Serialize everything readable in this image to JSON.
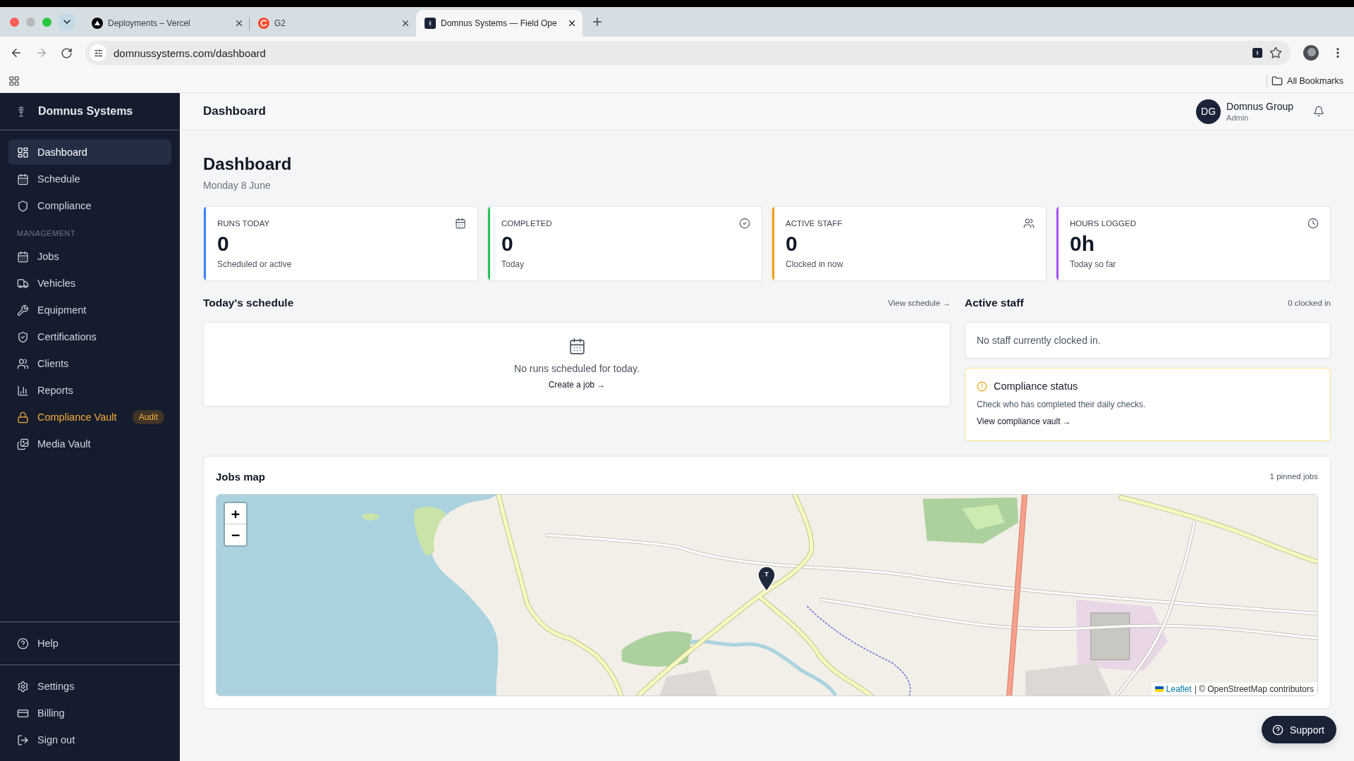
{
  "browser": {
    "tabs": [
      {
        "title": "Deployments – Vercel",
        "selected": false
      },
      {
        "title": "G2",
        "selected": false
      },
      {
        "title": "Domnus Systems — Field Ope",
        "selected": true
      }
    ],
    "forward_disabled": true,
    "url": "domnussystems.com/dashboard",
    "bookmarks_folder": "All Bookmarks"
  },
  "sidebar": {
    "brand": "Domnus Systems",
    "nav_groups": [
      {
        "items": [
          {
            "label": "Dashboard",
            "selected": true,
            "highlighted": false
          },
          {
            "label": "Schedule",
            "selected": false,
            "highlighted": false
          },
          {
            "label": "Compliance",
            "selected": false,
            "highlighted": false
          }
        ]
      },
      {
        "heading": "MANAGEMENT",
        "items": [
          {
            "label": "Jobs",
            "selected": false,
            "highlighted": false
          },
          {
            "label": "Vehicles",
            "selected": false,
            "highlighted": false
          },
          {
            "label": "Equipment",
            "selected": false,
            "highlighted": false
          },
          {
            "label": "Certifications",
            "selected": false,
            "highlighted": false
          },
          {
            "label": "Clients",
            "selected": false,
            "highlighted": false
          },
          {
            "label": "Reports",
            "selected": false,
            "highlighted": false
          },
          {
            "label": "Compliance Vault",
            "selected": false,
            "highlighted": true,
            "badge": "Audit"
          },
          {
            "label": "Media Vault",
            "selected": false,
            "highlighted": false
          }
        ]
      }
    ],
    "footer_groups": [
      {
        "items": [
          {
            "label": "Help",
            "selected": false,
            "highlighted": false
          }
        ]
      },
      {
        "items": [
          {
            "label": "Settings",
            "selected": false,
            "highlighted": false
          },
          {
            "label": "Billing",
            "selected": false,
            "highlighted": false
          },
          {
            "label": "Sign out",
            "selected": false,
            "highlighted": false
          }
        ]
      }
    ]
  },
  "header": {
    "title": "Dashboard",
    "user": {
      "initials": "DG",
      "name": "Domnus Group",
      "role": "Admin"
    }
  },
  "page": {
    "title": "Dashboard",
    "date": "Monday 8 June"
  },
  "stats": [
    {
      "label": "RUNS TODAY",
      "value": "0",
      "caption": "Scheduled or active",
      "color": "#3b82f6"
    },
    {
      "label": "COMPLETED",
      "value": "0",
      "caption": "Today",
      "color": "#22c55e"
    },
    {
      "label": "ACTIVE STAFF",
      "value": "0",
      "caption": "Clocked in now",
      "color": "#f59e0b"
    },
    {
      "label": "HOURS LOGGED",
      "value": "0h",
      "caption": "Today so far",
      "color": "#a855f7"
    }
  ],
  "schedule": {
    "title": "Today's schedule",
    "link": "View schedule →",
    "empty_text": "No runs scheduled for today.",
    "action": "Create a job →"
  },
  "active_staff": {
    "title": "Active staff",
    "count": "0 clocked in",
    "empty_text": "No staff currently clocked in."
  },
  "compliance": {
    "title": "Compliance status",
    "text": "Check who has completed their daily checks.",
    "link": "View compliance vault →"
  },
  "jobs_map": {
    "title": "Jobs map",
    "count": "1 pinned jobs",
    "zoom_in": "+",
    "zoom_out": "−",
    "pins": [
      {
        "label": "T"
      }
    ],
    "attribution": {
      "link": "Leaflet",
      "text": "| © OpenStreetMap contributors"
    }
  },
  "support_button": "Support"
}
